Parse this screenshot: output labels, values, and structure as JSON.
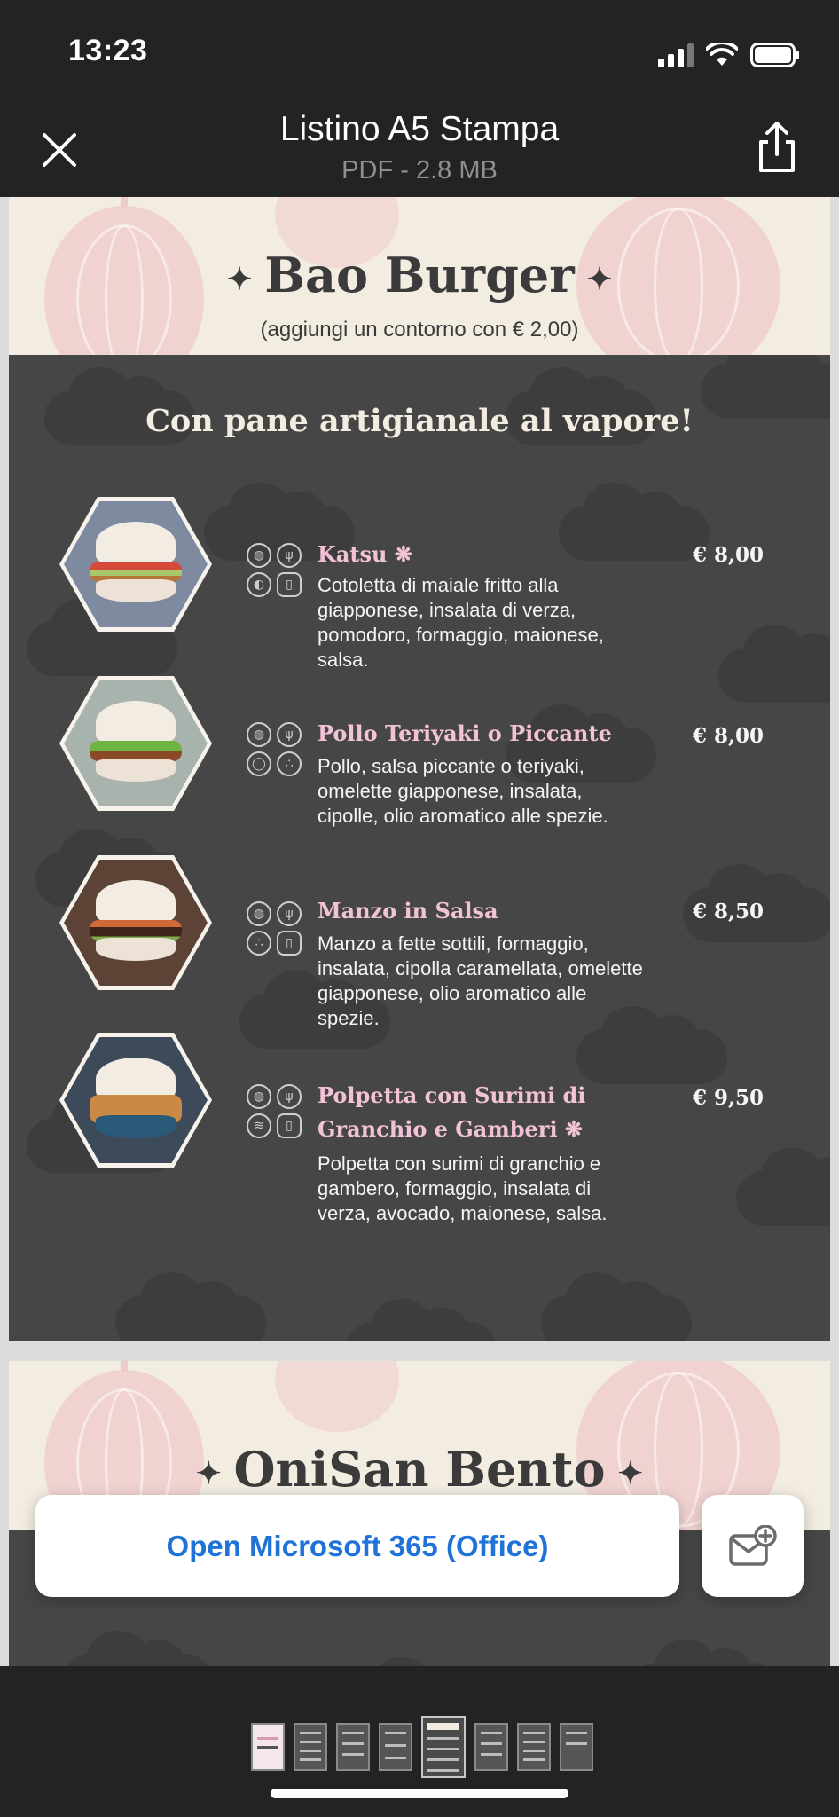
{
  "status_bar": {
    "time": "13:23",
    "signal_bars": 3,
    "battery_level": 0.9
  },
  "header": {
    "title": "Listino A5 Stampa",
    "subtitle": "PDF - 2.8 MB",
    "close_icon": "close-icon",
    "share_icon": "share-icon"
  },
  "document": {
    "page1": {
      "title": "Bao Burger",
      "star": "✦",
      "note": "(aggiungi un contorno con € 2,00)",
      "slogan": "Con pane artigianale al vapore!",
      "items": [
        {
          "name": "Katsu",
          "name_suffix": "❋",
          "description": "Cotoletta di maiale fritto alla giapponese, insalata di verza, pomodoro, formaggio, maionese, salsa.",
          "price": "€ 8,00",
          "allergens": [
            "gluten-icon",
            "wheat-icon",
            "mustard-icon",
            "milk-icon"
          ]
        },
        {
          "name": "Pollo Teriyaki o Piccante",
          "name_suffix": "",
          "description": "Pollo, salsa piccante o teriyaki, omelette giapponese, insalata, cipolle, olio aromatico alle spezie.",
          "price": "€ 8,00",
          "allergens": [
            "gluten-icon",
            "wheat-icon",
            "egg-icon",
            "sesame-icon"
          ]
        },
        {
          "name": "Manzo in Salsa",
          "name_suffix": "",
          "description": "Manzo a fette sottili, formaggio, insalata, cipolla caramellata, omelette giapponese, olio aromatico alle spezie.",
          "price": "€ 8,50",
          "allergens": [
            "gluten-icon",
            "wheat-icon",
            "sesame-icon",
            "milk-icon"
          ]
        },
        {
          "name": "Polpetta con Surimi di Granchio e Gamberi",
          "name_suffix": "❋",
          "description": "Polpetta con surimi di granchio e gambero, formaggio, insalata di verza, avocado, maionese, salsa.",
          "price": "€ 9,50",
          "allergens": [
            "gluten-icon",
            "wheat-icon",
            "shellfish-icon",
            "milk-icon"
          ]
        }
      ]
    },
    "page2": {
      "title": "OniSan Bento"
    }
  },
  "actions": {
    "open_office_label": "Open Microsoft 365 (Office)",
    "mail_icon": "mail-add-icon"
  },
  "thumbnails": {
    "count": 8,
    "active_index": 4
  },
  "colors": {
    "accent_link": "#1f73d8",
    "item_name_pink": "#f2c2d6",
    "banner_cream": "#f2ece1",
    "page_dark": "#464646"
  }
}
